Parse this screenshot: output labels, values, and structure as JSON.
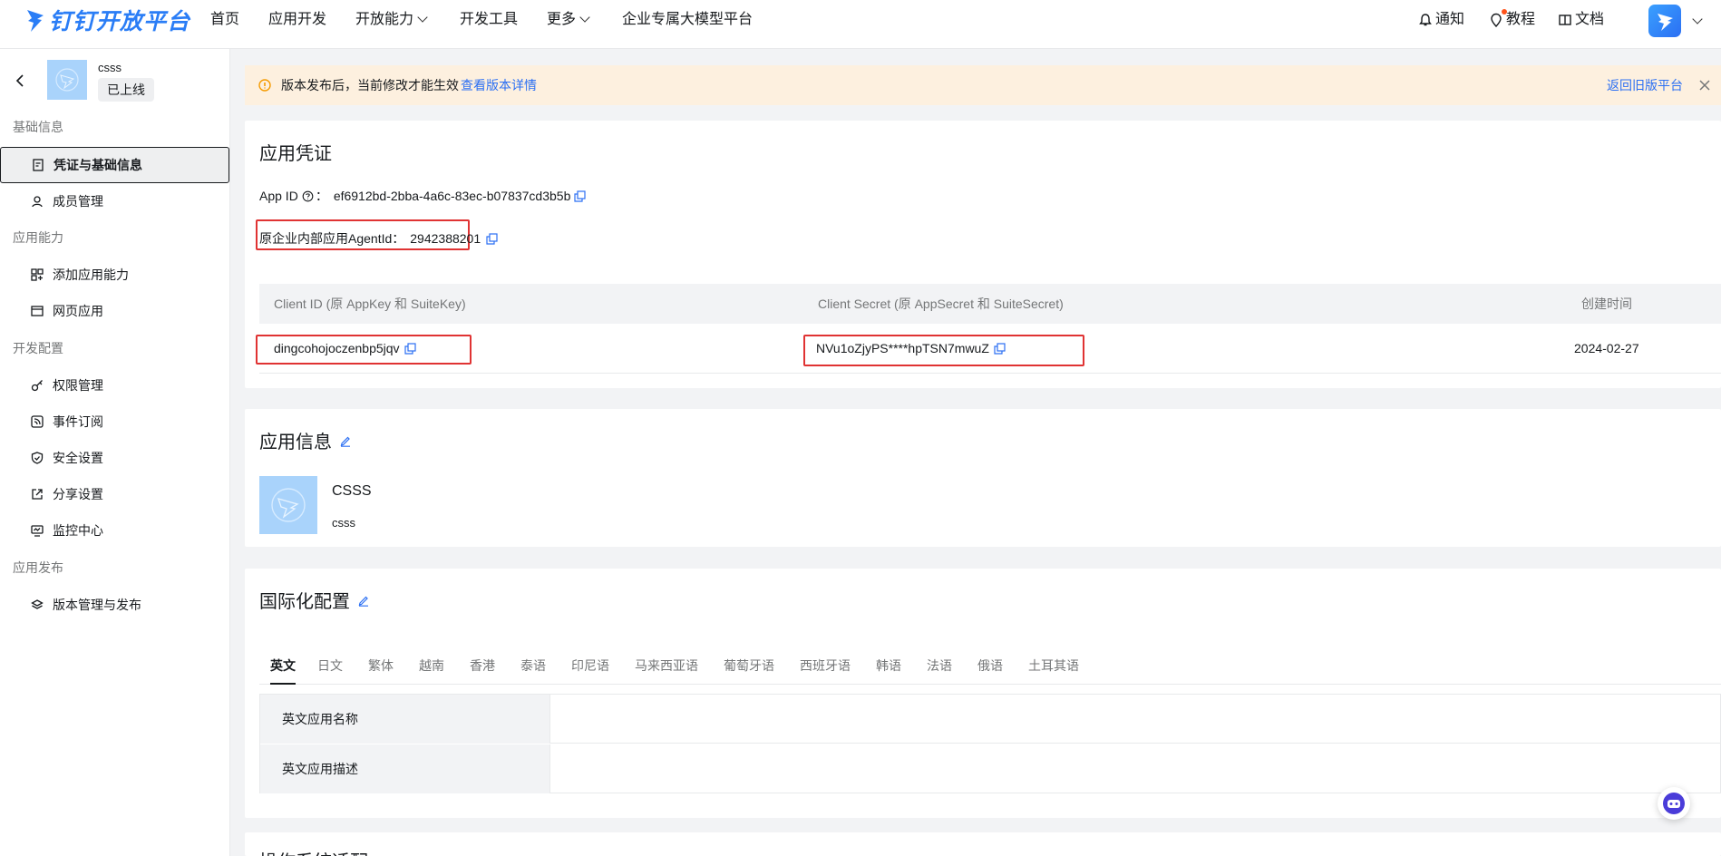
{
  "brand": {
    "logo_text": "钉钉开放平台"
  },
  "topnav": {
    "items": [
      "首页",
      "应用开发",
      "开放能力",
      "开发工具",
      "更多",
      "企业专属大模型平台"
    ],
    "notify": "通知",
    "tutorial": "教程",
    "docs": "文档"
  },
  "sidebar": {
    "app_name": "csss",
    "status": "已上线",
    "groups": {
      "basic": "基础信息",
      "ability": "应用能力",
      "dev": "开发配置",
      "publish": "应用发布"
    },
    "items": {
      "credentials": "凭证与基础信息",
      "members": "成员管理",
      "add_ability": "添加应用能力",
      "web_app": "网页应用",
      "permissions": "权限管理",
      "events": "事件订阅",
      "security": "安全设置",
      "share": "分享设置",
      "monitor": "监控中心",
      "versions": "版本管理与发布"
    }
  },
  "notice": {
    "text": "版本发布后，当前修改才能生效",
    "link": "查看版本详情",
    "back_old": "返回旧版平台"
  },
  "credentials": {
    "title": "应用凭证",
    "app_id_label": "App ID",
    "app_id_value": "ef6912bd-2bba-4a6c-83ec-b07837cd3b5b",
    "agent_label": "原企业内部应用AgentId：",
    "agent_value": "2942388201",
    "table": {
      "col_client_id": "Client ID (原 AppKey 和 SuiteKey)",
      "col_client_secret": "Client Secret (原 AppSecret 和 SuiteSecret)",
      "col_created": "创建时间",
      "client_id": "dingcohojoczenbp5jqv",
      "client_secret": "NVu1oZjyPS****hpTSN7mwuZ",
      "created": "2024-02-27"
    }
  },
  "app_info": {
    "title": "应用信息",
    "name": "CSSS",
    "desc": "csss"
  },
  "i18n": {
    "title": "国际化配置",
    "tabs": [
      "英文",
      "日文",
      "繁体",
      "越南",
      "香港",
      "泰语",
      "印尼语",
      "马来西亚语",
      "葡萄牙语",
      "西班牙语",
      "韩语",
      "法语",
      "俄语",
      "土耳其语"
    ],
    "row1": "英文应用名称",
    "row2": "英文应用描述"
  },
  "next_section": {
    "title": "操作系统适配"
  },
  "colors": {
    "brand": "#2b6ff3",
    "highlight": "#e03333",
    "notice_bg": "#fdf0df"
  }
}
